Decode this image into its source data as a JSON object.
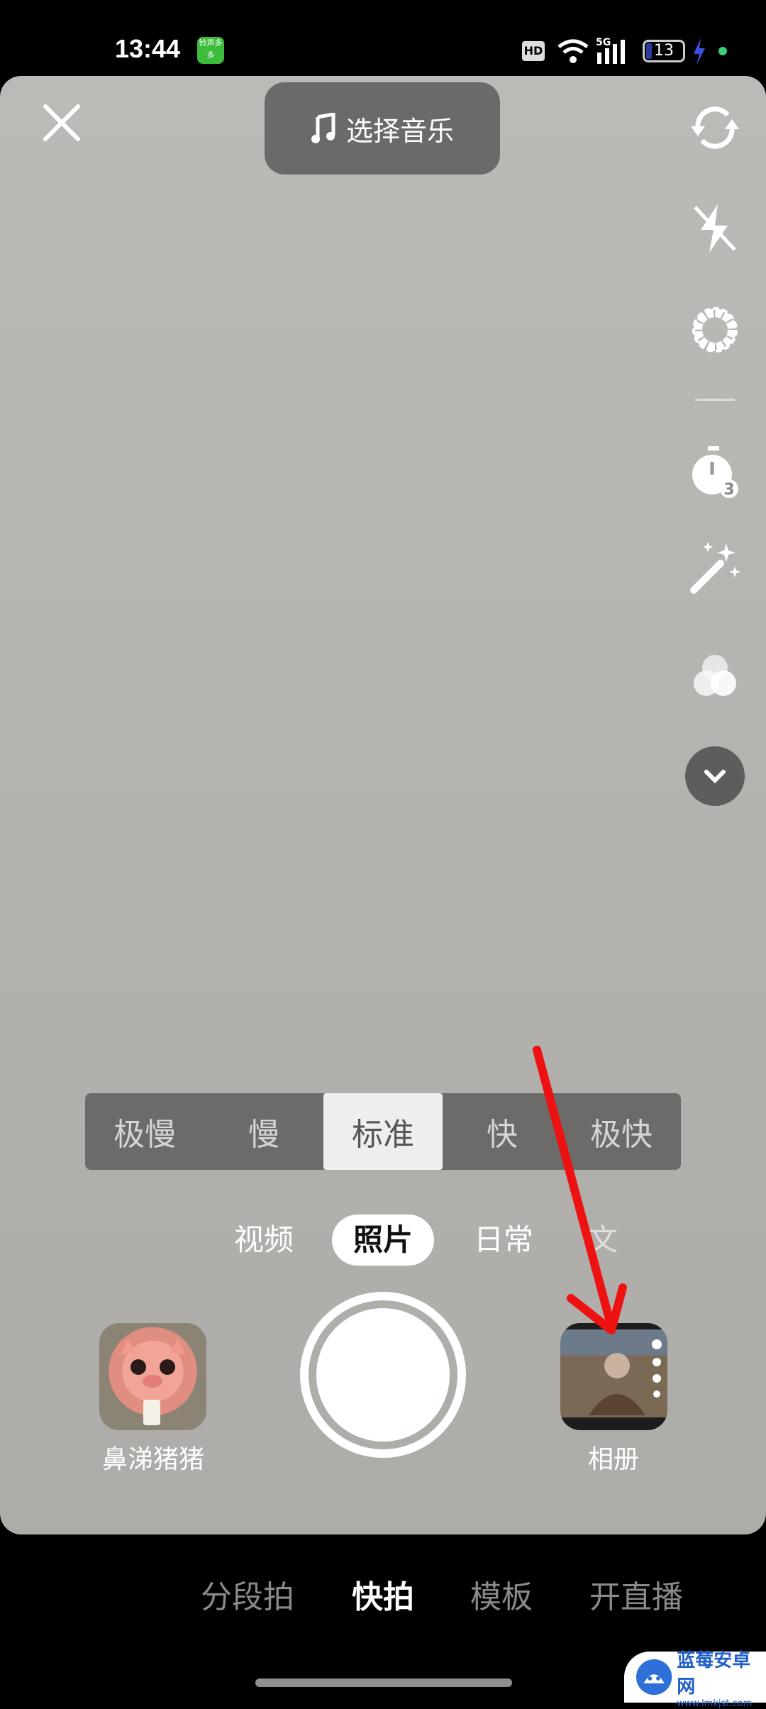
{
  "status_bar": {
    "time": "13:44",
    "app_badge": "铃声多多",
    "hd": "HD",
    "network": "5G",
    "battery": "13",
    "icons": [
      "wifi-icon",
      "signal-icon",
      "battery-icon",
      "charging-icon"
    ]
  },
  "top": {
    "close_icon": "close-icon",
    "music_label": "选择音乐",
    "music_icon": "music-note-icon"
  },
  "side_tools": [
    "flip-camera-icon",
    "flash-off-icon",
    "settings-icon",
    "timer-3-icon",
    "magic-wand-icon",
    "filters-icon",
    "chevron-down-icon"
  ],
  "speed": {
    "options": [
      "极慢",
      "慢",
      "标准",
      "快",
      "极快"
    ],
    "selected": "标准"
  },
  "modes": {
    "items": [
      "视频",
      "照片",
      "日常",
      "文"
    ],
    "selected": "照片"
  },
  "effect": {
    "label": "鼻涕猪猪"
  },
  "album": {
    "label": "相册"
  },
  "bottom_tabs": {
    "items": [
      "分段拍",
      "快拍",
      "模板",
      "开直播"
    ],
    "selected": "快拍"
  },
  "watermark": {
    "text": "蓝莓安卓网",
    "url": "www.lmkjst.com"
  },
  "colors": {
    "annotation_arrow": "#ee1111",
    "camera_bg": "#b8b6b2"
  }
}
